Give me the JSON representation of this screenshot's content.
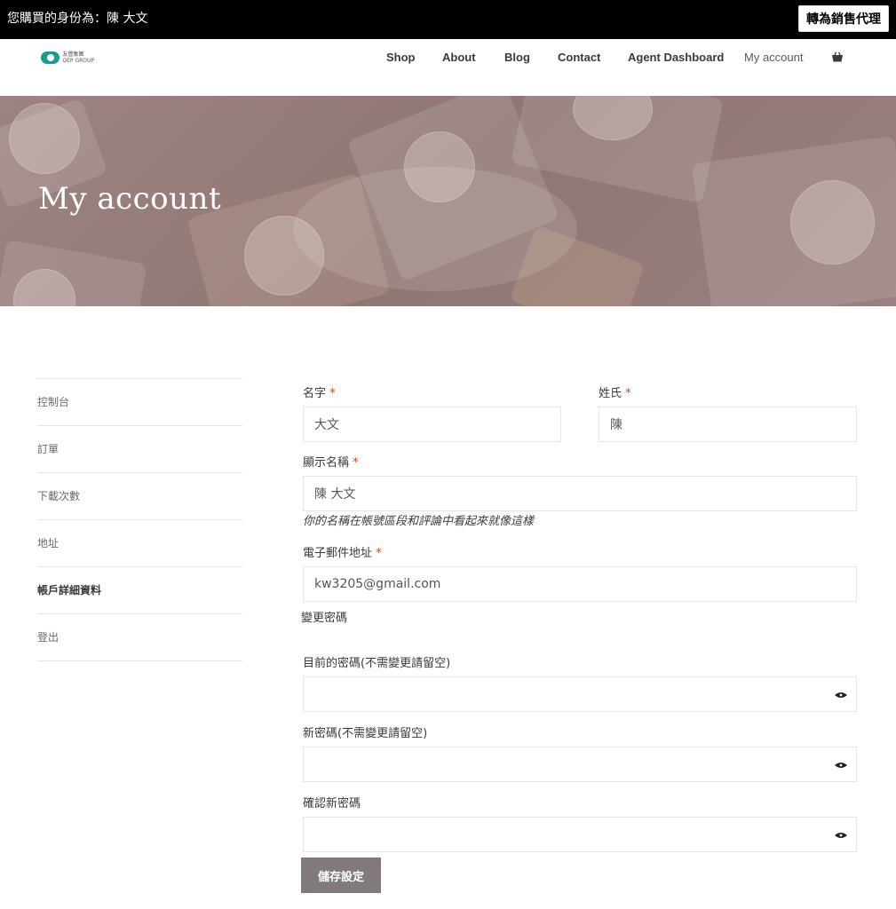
{
  "topbar": {
    "status": "您購買的身份為：陳 大文",
    "switch_label": "轉為銷售代理"
  },
  "logo": {
    "line1": "友豐集團",
    "line2": "OEP GROUP"
  },
  "nav": {
    "items": [
      {
        "label": "Shop"
      },
      {
        "label": "About"
      },
      {
        "label": "Blog"
      },
      {
        "label": "Contact"
      },
      {
        "label": "Agent Dashboard"
      },
      {
        "label": "My account"
      }
    ],
    "cart_icon": "shopping-bag-icon"
  },
  "hero": {
    "title": "My account"
  },
  "sidebar": {
    "items": [
      {
        "label": "控制台"
      },
      {
        "label": "訂單"
      },
      {
        "label": "下載次數"
      },
      {
        "label": "地址"
      },
      {
        "label": "帳戶詳細資料",
        "active": true
      },
      {
        "label": "登出"
      }
    ]
  },
  "form": {
    "first_name": {
      "label": "名字",
      "value": "大文"
    },
    "last_name": {
      "label": "姓氏",
      "value": "陳"
    },
    "display_name": {
      "label": "顯示名稱",
      "value": "陳 大文",
      "hint": "你的名稱在帳號區段和評論中看起來就像這樣"
    },
    "email": {
      "label": "電子郵件地址",
      "value": "kw3205@gmail.com"
    },
    "required_mark": "*",
    "password_section": "變更密碼",
    "current_password": {
      "label": "目前的密碼(不需變更請留空)",
      "value": ""
    },
    "new_password": {
      "label": "新密碼(不需變更請留空)",
      "value": ""
    },
    "confirm_password": {
      "label": "確認新密碼",
      "value": ""
    },
    "save_label": "儲存設定"
  },
  "colors": {
    "topbar_bg": "#000000",
    "required": "#e2401c",
    "button_bg": "#827a7a",
    "hero_tint": "#947b7a"
  }
}
